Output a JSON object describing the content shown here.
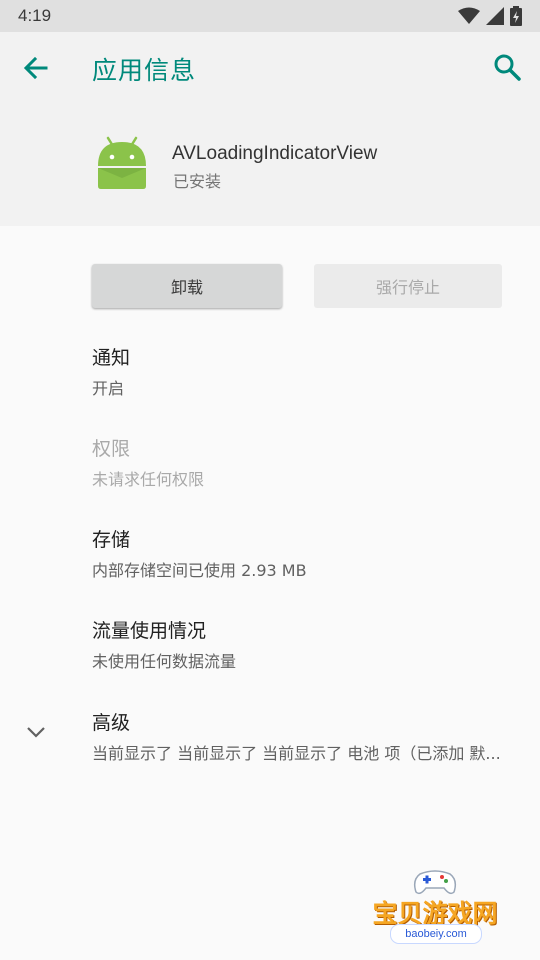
{
  "status_bar": {
    "time": "4:19",
    "icons": [
      "wifi-icon",
      "signal-icon",
      "battery-icon"
    ]
  },
  "toolbar": {
    "title": "应用信息",
    "back_icon": "arrow-back-icon",
    "search_icon": "search-icon",
    "accent": "#00897b"
  },
  "app": {
    "name": "AVLoadingIndicatorView",
    "status": "已安装",
    "icon": "android-robot-icon",
    "icon_color": "#8bc34a"
  },
  "buttons": {
    "uninstall": "卸载",
    "force_stop": "强行停止"
  },
  "settings": {
    "notifications": {
      "title": "通知",
      "summary": "开启"
    },
    "permissions": {
      "title": "权限",
      "summary": "未请求任何权限"
    },
    "storage": {
      "title": "存储",
      "summary": "内部存储空间已使用 2.93 MB"
    },
    "data_usage": {
      "title": "流量使用情况",
      "summary": "未使用任何数据流量"
    },
    "advanced": {
      "title": "高级",
      "summary": "当前显示了 当前显示了 当前显示了 电池 项（已添加 默..."
    }
  },
  "watermark": {
    "text": "宝贝游戏网",
    "url": "baobeiy.com"
  }
}
